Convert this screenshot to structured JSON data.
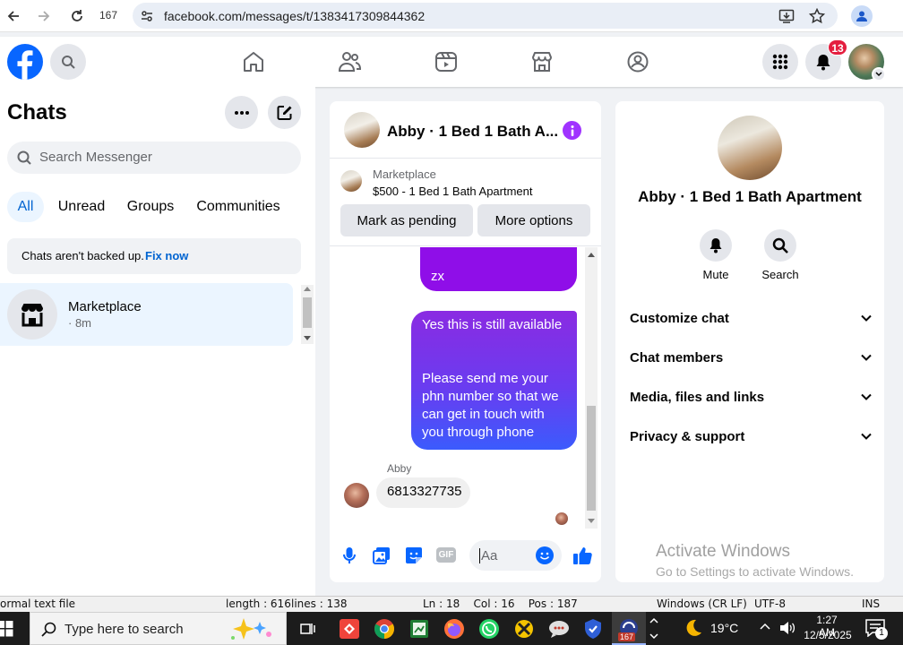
{
  "browser": {
    "tab_count": "167",
    "url": "facebook.com/messages/t/1383417309844362"
  },
  "header": {
    "notifications_badge": "13"
  },
  "sidebar": {
    "title": "Chats",
    "search_placeholder": "Search Messenger",
    "filters": [
      "All",
      "Unread",
      "Groups",
      "Communities"
    ],
    "backup_text": "Chats aren't backed up.",
    "backup_link": "Fix now",
    "chats": [
      {
        "name": "Marketplace",
        "time": "· 8m"
      }
    ]
  },
  "conversation": {
    "title": "Abby · 1 Bed 1 Bath A...",
    "listing": {
      "source": "Marketplace",
      "price_title": "$500 - 1 Bed 1 Bath Apartment"
    },
    "mark_pending_label": "Mark as pending",
    "more_options_label": "More options",
    "messages": [
      {
        "from": "me",
        "text": "zx"
      },
      {
        "from": "me",
        "text": "Yes this is still available"
      },
      {
        "from": "me",
        "text": "Please send me your phn number so that we can get in touch with you through phone"
      },
      {
        "from": "Abby",
        "sender_label": "Abby",
        "text": "6813327735"
      }
    ],
    "composer_placeholder": "Aa"
  },
  "details": {
    "name": "Abby · 1 Bed 1 Bath Apartment",
    "actions": [
      {
        "label": "Mute",
        "icon": "bell-icon"
      },
      {
        "label": "Search",
        "icon": "search-icon"
      }
    ],
    "sections": [
      "Customize chat",
      "Chat members",
      "Media, files and links",
      "Privacy & support"
    ],
    "watermark_title": "Activate Windows",
    "watermark_sub": "Go to Settings to activate Windows."
  },
  "editor_status": {
    "file_type": "ormal text file",
    "length": "length : 616",
    "lines": "lines : 138",
    "position": "Ln : 18    Col : 16    Pos : 187",
    "eol": "Windows (CR LF)",
    "encoding": "UTF-8",
    "mode": "INS"
  },
  "taskbar": {
    "search_placeholder": "Type here to search",
    "weather": "19°C",
    "time": "1:27 AM",
    "date": "12/5/2025",
    "app_badge": "167",
    "notif_count": "1"
  },
  "colors": {
    "fb_blue": "#0866ff",
    "bubble_purple": "#8a2be2",
    "bubble_blue": "#3b5bfd",
    "badge_red": "#e41e3f"
  }
}
